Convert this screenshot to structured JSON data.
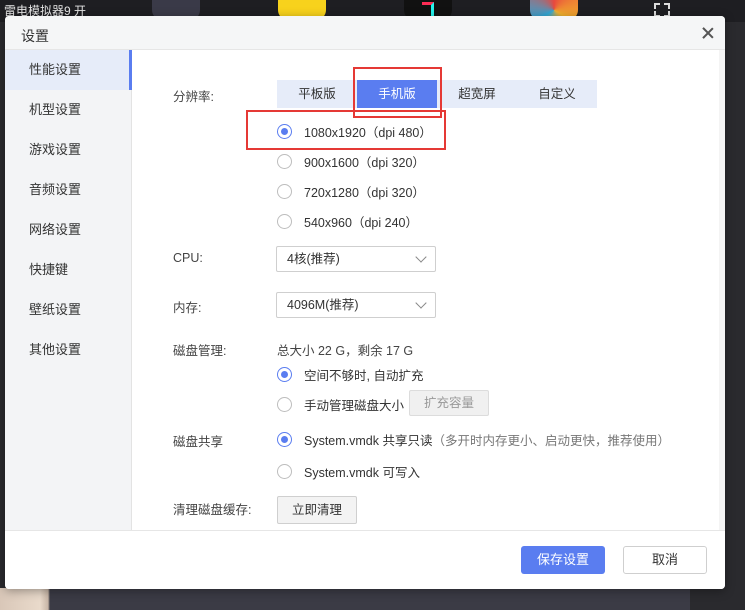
{
  "background": {
    "window_title": "雷电模拟器9  开"
  },
  "dialog": {
    "title": "设置"
  },
  "sidebar": {
    "items": [
      {
        "label": "性能设置"
      },
      {
        "label": "机型设置"
      },
      {
        "label": "游戏设置"
      },
      {
        "label": "音频设置"
      },
      {
        "label": "网络设置"
      },
      {
        "label": "快捷键"
      },
      {
        "label": "壁纸设置"
      },
      {
        "label": "其他设置"
      }
    ]
  },
  "performance": {
    "resolution": {
      "label": "分辨率:",
      "tabs": [
        "平板版",
        "手机版",
        "超宽屏",
        "自定义"
      ],
      "selected_tab": "手机版",
      "options": [
        "1080x1920（dpi 480）",
        "900x1600（dpi 320）",
        "720x1280（dpi 320）",
        "540x960（dpi 240）"
      ],
      "selected_option": "1080x1920（dpi 480）"
    },
    "cpu": {
      "label": "CPU:",
      "value": "4核(推荐)"
    },
    "memory": {
      "label": "内存:",
      "value": "4096M(推荐)"
    },
    "disk_management": {
      "label": "磁盘管理:",
      "summary": "总大小 22 G，剩余 17 G",
      "options": [
        "空间不够时, 自动扩充",
        "手动管理磁盘大小"
      ],
      "selected_option": "空间不够时, 自动扩充",
      "expand_button": "扩充容量"
    },
    "disk_sharing": {
      "label": "磁盘共享",
      "options": [
        "System.vmdk 共享只读",
        "System.vmdk 可写入"
      ],
      "readonly_hint": "（多开时内存更小、启动更快，推荐使用）",
      "selected_option": "System.vmdk 共享只读"
    },
    "clear_cache": {
      "label": "清理磁盘缓存:",
      "button": "立即清理"
    }
  },
  "footer": {
    "save_label": "保存设置",
    "cancel_label": "取消"
  },
  "colors": {
    "accent": "#5a7df0",
    "highlight_box": "#e53935"
  }
}
